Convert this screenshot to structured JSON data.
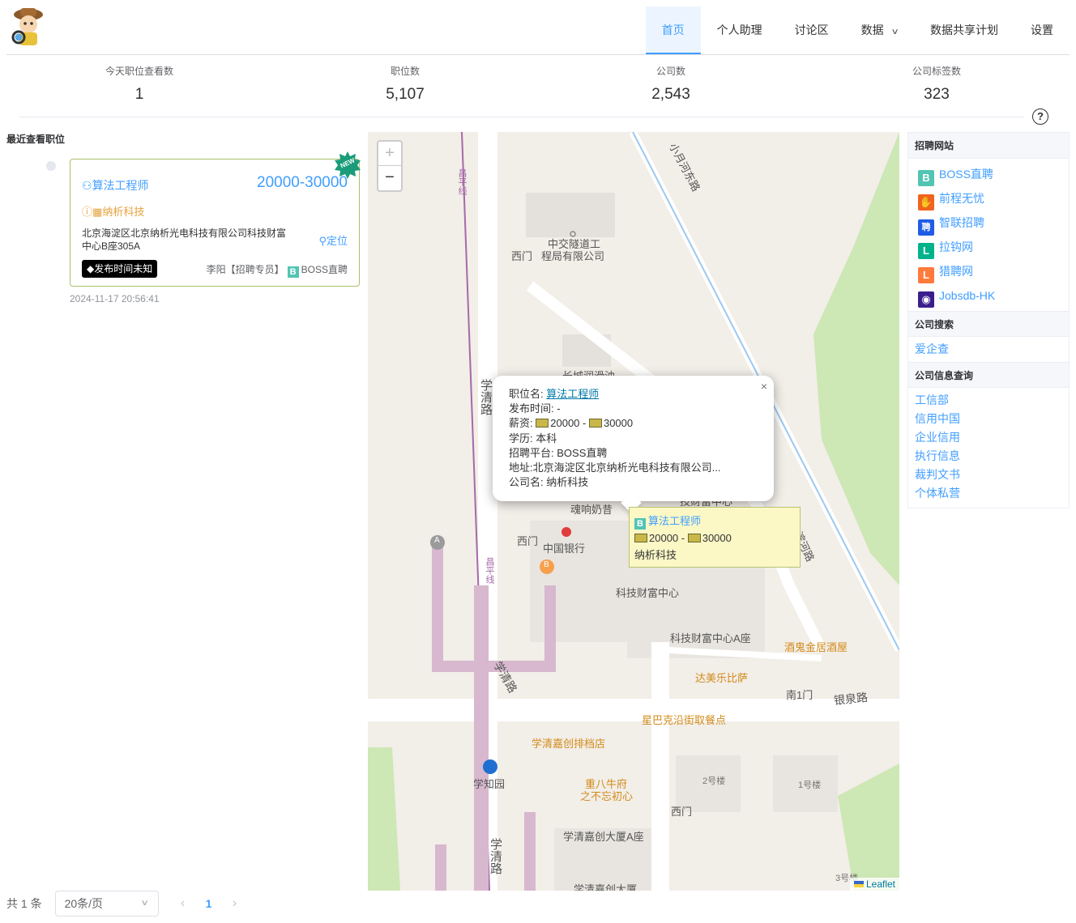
{
  "nav": [
    {
      "label": "首页",
      "active": true
    },
    {
      "label": "个人助理"
    },
    {
      "label": "讨论区"
    },
    {
      "label": "数据",
      "dropdown": true
    },
    {
      "label": "数据共享计划"
    },
    {
      "label": "设置"
    }
  ],
  "stats": [
    {
      "label": "今天职位查看数",
      "value": "1"
    },
    {
      "label": "职位数",
      "value": "5,107"
    },
    {
      "label": "公司数",
      "value": "2,543"
    },
    {
      "label": "公司标签数",
      "value": "323"
    }
  ],
  "recent": {
    "title": "最近查看职位",
    "card": {
      "badge": "NEW",
      "job_title": "算法工程师",
      "salary": "20000-30000",
      "company": "纳析科技",
      "address": "北京海淀区北京纳析光电科技有限公司科技财富中心B座305A",
      "locate_label": "定位",
      "publish_tag": "发布时间未知",
      "recruiter": "李阳【招聘专员】",
      "platform": "BOSS直聘"
    },
    "viewed_time": "2024-11-17 20:56:41"
  },
  "map": {
    "zoom_in": "+",
    "zoom_out": "−",
    "attribution": "Leaflet",
    "popup": {
      "close": "×",
      "job_label": "职位名:",
      "job_value": "算法工程师",
      "time_label": "发布时间:",
      "time_value": "-",
      "salary_label": "薪资:",
      "salary_low": "20000",
      "salary_sep": " - ",
      "salary_high": "30000",
      "edu_label": "学历:",
      "edu_value": "本科",
      "platform_label": "招聘平台:",
      "platform_value": "BOSS直聘",
      "addr_label": "地址:",
      "addr_value": "北京海淀区北京纳析光电科技有限公司...",
      "company_label": "公司名:",
      "company_value": "纳析科技"
    },
    "marker": {
      "title": "算法工程师",
      "salary_low": "20000",
      "salary_sep": " - ",
      "salary_high": "30000",
      "company": "纳析科技"
    },
    "labels": {
      "changping": "昌平线",
      "changping2": "昌平线",
      "xiaoyuehe": "小月河东路",
      "zhongjiao": "中交隧道工",
      "zhongjiao2": "程局有限公司",
      "ximen1": "西门",
      "changcheng": "长城润滑油",
      "xueqinglu1": "学清路",
      "ximen2": "西门",
      "bank": "中国银行",
      "hunxiang": "魂响奶昔",
      "kejicaifu_top": "技财富中心",
      "kejicaifu": "科技财富中心",
      "kejicaifu_a": "科技财富中心A座",
      "binhe": "滨河路",
      "jiugui": "酒鬼金居酒屋",
      "dameile": "达美乐比萨",
      "nan1men": "南1门",
      "yinquan": "银泉路",
      "starbucks": "星巴克沿街取餐点",
      "xueqinglu2": "学清路",
      "jiachuang_pai": "学清嘉创排档店",
      "chongba": "重八牛府",
      "chongba2": "之不忘初心",
      "xuezhiyuan": "学知园",
      "ximen3": "西门",
      "lou2": "2号楼",
      "lou1": "1号楼",
      "jiachuang_a": "学清嘉创大厦A座",
      "xueqinglu3": "学清路",
      "jiachuang": "学清嘉创大厦",
      "lou3": "3号楼",
      "stopA": "A",
      "stopB": "B"
    }
  },
  "side": {
    "sections": [
      {
        "title": "招聘网站",
        "items": [
          {
            "label": "BOSS直聘",
            "icon": "boss-icon",
            "glyph": "B",
            "color": "#52c4b4"
          },
          {
            "label": "前程无忧",
            "icon": "51job-icon",
            "glyph": "✋",
            "color": "#f0641e"
          },
          {
            "label": "智联招聘",
            "icon": "zhaopin-icon",
            "glyph": "聘",
            "color": "#1f5de6"
          },
          {
            "label": "拉钩网",
            "icon": "lagou-icon",
            "glyph": "L",
            "color": "#00b38a"
          },
          {
            "label": "猎聘网",
            "icon": "liepin-icon",
            "glyph": "L",
            "color": "#ff7a3c"
          },
          {
            "label": "Jobsdb-HK",
            "icon": "jobsdb-icon",
            "glyph": "◉",
            "color": "#3a1f8c"
          }
        ]
      },
      {
        "title": "公司搜索",
        "items": [
          {
            "label": "爱企查"
          }
        ]
      },
      {
        "title": "公司信息查询",
        "items": [
          {
            "label": "工信部"
          },
          {
            "label": "信用中国"
          },
          {
            "label": "企业信用"
          },
          {
            "label": "执行信息"
          },
          {
            "label": "裁判文书"
          },
          {
            "label": "个体私营"
          }
        ]
      }
    ]
  },
  "pagination": {
    "total": "共 1 条",
    "page_size": "20条/页",
    "current": "1",
    "prev": "‹",
    "next": "›"
  },
  "colors": {
    "accent": "#409eff",
    "orange": "#e6a23c"
  }
}
